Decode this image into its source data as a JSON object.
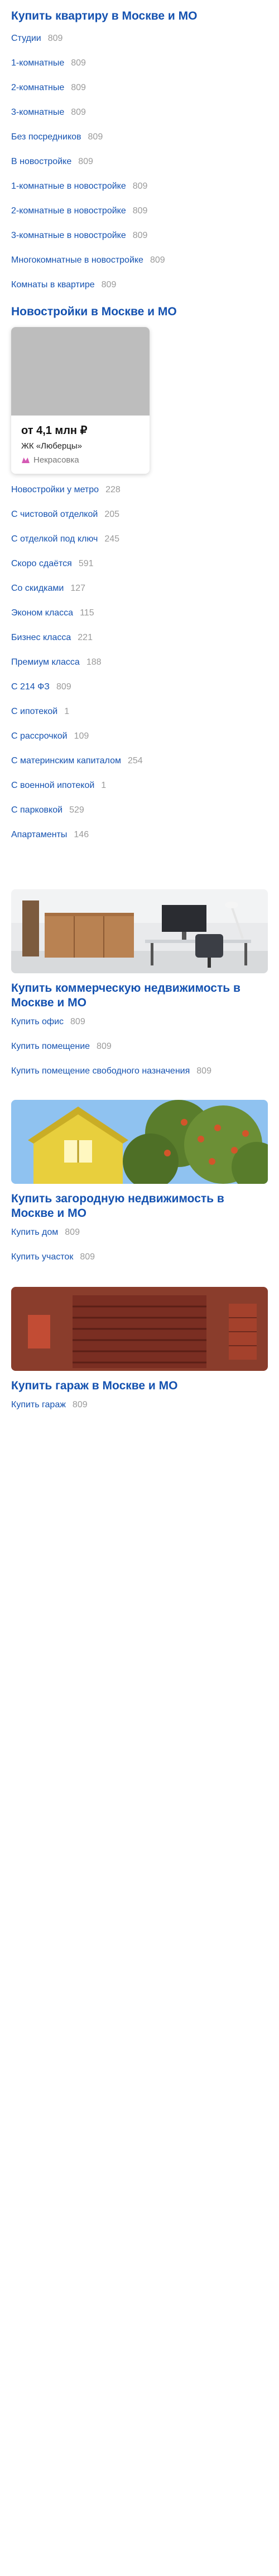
{
  "apartments": {
    "title": "Купить квартиру в Москве и МО",
    "links": [
      {
        "label": "Студии",
        "count": "809"
      },
      {
        "label": "1-комнатные",
        "count": "809"
      },
      {
        "label": "2-комнатные",
        "count": "809"
      },
      {
        "label": "3-комнатные",
        "count": "809"
      },
      {
        "label": "Без посредников",
        "count": "809"
      },
      {
        "label": "В новостройке",
        "count": "809"
      },
      {
        "label": "1-комнатные в новостройке",
        "count": "809"
      },
      {
        "label": "2-комнатные в новостройке",
        "count": "809"
      },
      {
        "label": "3-комнатные в новостройке",
        "count": "809"
      },
      {
        "label": "Многокомнатные в новостройке",
        "count": "809"
      },
      {
        "label": "Комнаты в квартире",
        "count": "809"
      }
    ]
  },
  "newbuildings": {
    "title": "Новостройки в Москве и МО",
    "card": {
      "price": "от 4,1 млн ₽",
      "complex": "ЖК «Люберцы»",
      "metro": "Некрасовка",
      "metro_color": "#d45ab4"
    },
    "links": [
      {
        "label": "Новостройки у метро",
        "count": "228"
      },
      {
        "label": "С чистовой отделкой",
        "count": "205"
      },
      {
        "label": "С отделкой под ключ",
        "count": "245"
      },
      {
        "label": "Скоро сдаётся",
        "count": "591"
      },
      {
        "label": "Со скидками",
        "count": "127"
      },
      {
        "label": "Эконом класса",
        "count": "115"
      },
      {
        "label": "Бизнес класса",
        "count": "221"
      },
      {
        "label": "Премиум класса",
        "count": "188"
      },
      {
        "label": "С 214 ФЗ",
        "count": "809"
      },
      {
        "label": "С ипотекой",
        "count": "1"
      },
      {
        "label": "С рассрочкой",
        "count": "109"
      },
      {
        "label": "С материнским капиталом",
        "count": "254"
      },
      {
        "label": "С военной ипотекой",
        "count": "1"
      },
      {
        "label": "С парковкой",
        "count": "529"
      },
      {
        "label": "Апартаменты",
        "count": "146"
      }
    ]
  },
  "commercial": {
    "title": "Купить коммерческую недвижимость в Москве и МО",
    "links": [
      {
        "label": "Купить офис",
        "count": "809"
      },
      {
        "label": "Купить помещение",
        "count": "809"
      },
      {
        "label": "Купить помещение свободного назначения",
        "count": "809"
      }
    ]
  },
  "country": {
    "title": "Купить загородную недвижимость в Москве и МО",
    "links": [
      {
        "label": "Купить дом",
        "count": "809"
      },
      {
        "label": "Купить участок",
        "count": "809"
      }
    ]
  },
  "garage": {
    "title": "Купить гараж в Москве и МО",
    "links": [
      {
        "label": "Купить гараж",
        "count": "809"
      }
    ]
  },
  "colors": {
    "link": "#1552b0",
    "count": "#9a9a9a"
  }
}
